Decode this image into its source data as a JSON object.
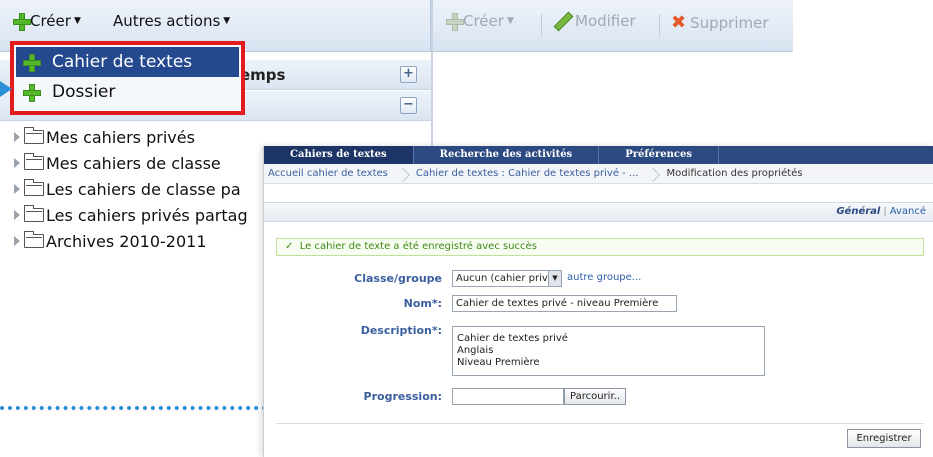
{
  "left_toolbar": {
    "create_label": "Créer",
    "other_actions_label": "Autres actions"
  },
  "create_menu": {
    "items": [
      {
        "label": "Cahier de textes",
        "icon": "plus-icon",
        "selected": true
      },
      {
        "label": "Dossier",
        "icon": "plus-icon",
        "selected": false
      }
    ]
  },
  "panel": {
    "title_partial": "emps"
  },
  "tree": {
    "items": [
      {
        "label": "Mes cahiers privés"
      },
      {
        "label": "Mes cahiers de classe"
      },
      {
        "label": "Les cahiers de classe pa"
      },
      {
        "label": "Les cahiers privés partag"
      },
      {
        "label": "Archives 2010-2011"
      }
    ]
  },
  "right_toolbar": {
    "create_label": "Créer",
    "edit_label": "Modifier",
    "delete_label": "Supprimer"
  },
  "form": {
    "tabs": [
      {
        "label": "Cahiers de textes",
        "active": true
      },
      {
        "label": "Recherche des activités",
        "active": false
      },
      {
        "label": "Préférences",
        "active": false
      }
    ],
    "breadcrumb": [
      "Accueil cahier de textes",
      "Cahier de textes : Cahier de textes privé - ...",
      "Modification des propriétés"
    ],
    "view_general": "Général",
    "view_advanced": "Avancé",
    "success_message": "Le cahier de texte a été enregistré avec succès",
    "classe_label": "Classe/groupe",
    "classe_value": "Aucun (cahier privé",
    "other_group_link": "autre groupe...",
    "nom_label": "Nom*:",
    "nom_value": "Cahier de textes privé - niveau Première",
    "description_label": "Description*:",
    "description_lines": [
      "Cahier de textes privé",
      "Anglais",
      "Niveau Première"
    ],
    "progression_label": "Progression:",
    "browse_label": "Parcourir..",
    "save_label": "Enregistrer"
  },
  "colors": {
    "highlight_border": "#e21c1c",
    "menu_selected": "#25498f",
    "arrow": "#2b8fd6",
    "tab_bar": "#2c4a82",
    "success_text": "#3f8a19"
  }
}
